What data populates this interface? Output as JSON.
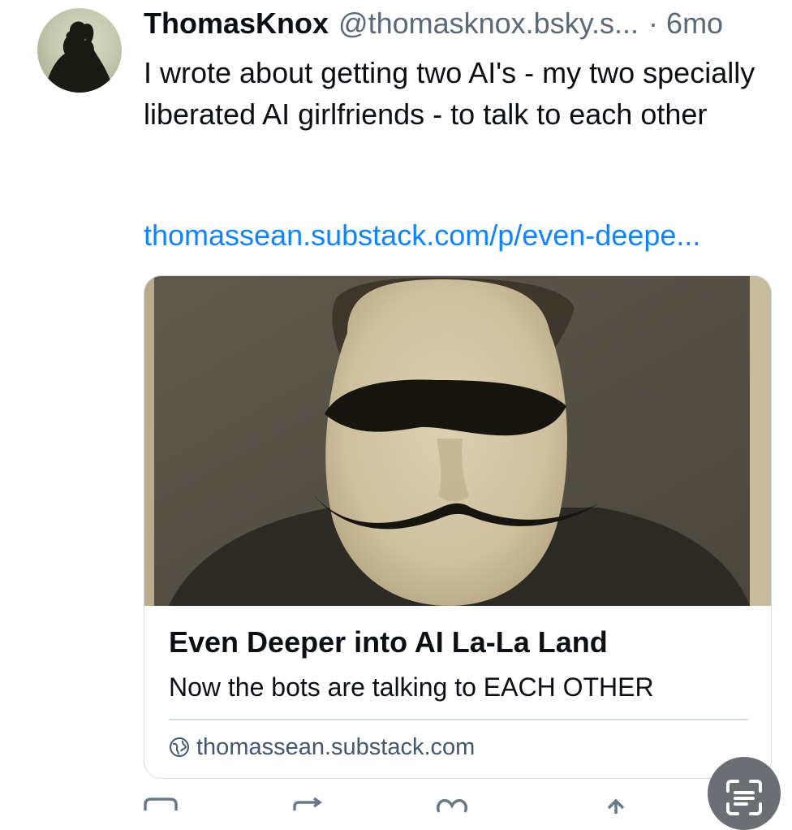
{
  "post": {
    "author_name": "ThomasKnox",
    "handle": "@thomasknox.bsky.s...",
    "separator": "·",
    "time_ago": "6mo",
    "text": "I wrote about getting two AI's - my two specially liberated AI girlfriends - to talk to each other",
    "link": "thomassean.substack.com/p/even-deepe..."
  },
  "link_card": {
    "title": "Even Deeper into AI La-La Land",
    "description": "Now the bots are talking to EACH OTHER",
    "domain": "thomassean.substack.com",
    "domain_icon": "globe-icon"
  },
  "actions": [
    {
      "icon": "reply-icon"
    },
    {
      "icon": "repost-icon"
    },
    {
      "icon": "like-icon"
    },
    {
      "icon": "share-icon"
    }
  ],
  "floating_button": {
    "icon": "scan-text-icon"
  },
  "colors": {
    "link": "#1083fe",
    "muted": "#5a6877",
    "border": "#d4dbe2"
  }
}
